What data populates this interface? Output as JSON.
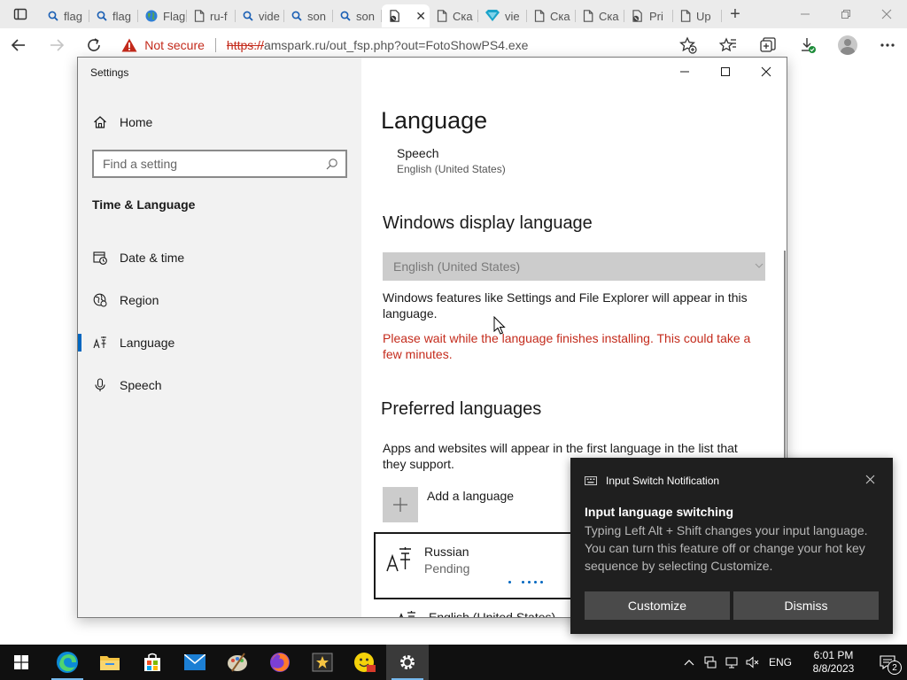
{
  "browser": {
    "tabs": [
      {
        "label": "flag",
        "icon": "search-icon"
      },
      {
        "label": "flag",
        "icon": "search-icon"
      },
      {
        "label": "Flag",
        "icon": "globe-icon"
      },
      {
        "label": "ru-f",
        "icon": "page-icon"
      },
      {
        "label": "vide",
        "icon": "search-icon"
      },
      {
        "label": "son",
        "icon": "search-icon"
      },
      {
        "label": "son",
        "icon": "search-icon"
      },
      {
        "label": "",
        "icon": "blocked-page-icon",
        "active": true
      },
      {
        "label": "Ска",
        "icon": "page-icon"
      },
      {
        "label": "vie",
        "icon": "diamond-icon"
      },
      {
        "label": "Ска",
        "icon": "page-icon"
      },
      {
        "label": "Ска",
        "icon": "page-icon"
      },
      {
        "label": "Pri",
        "icon": "blocked-page-icon"
      },
      {
        "label": "Up",
        "icon": "page-icon"
      }
    ],
    "security_label": "Not secure",
    "url_scheme": "https://",
    "url_rest": "amspark.ru/out_fsp.php?out=FotoShowPS4.exe"
  },
  "settings": {
    "window_title": "Settings",
    "home_label": "Home",
    "search_placeholder": "Find a setting",
    "section_heading": "Time & Language",
    "nav": {
      "date_time": "Date & time",
      "region": "Region",
      "language": "Language",
      "speech": "Speech"
    },
    "page_title": "Language",
    "speech_name": "Speech",
    "speech_value": "English (United States)",
    "display_heading": "Windows display language",
    "display_dropdown_value": "English (United States)",
    "display_desc": "Windows features like Settings and File Explorer will appear in this language.",
    "install_warning": "Please wait while the language finishes installing. This could take a few minutes.",
    "preferred_heading": "Preferred languages",
    "preferred_desc": "Apps and websites will appear in the first language in the list that they support.",
    "add_language_label": "Add a language",
    "languages": [
      {
        "name": "Russian",
        "status": "Pending"
      },
      {
        "name": "English (United States)"
      }
    ]
  },
  "toast": {
    "app_name": "Input Switch Notification",
    "title": "Input language switching",
    "body": "Typing Left Alt + Shift changes your input language. You can turn this feature off or change your hot key sequence by selecting Customize.",
    "customize_label": "Customize",
    "dismiss_label": "Dismiss"
  },
  "taskbar": {
    "input_language": "ENG",
    "time": "6:01 PM",
    "date": "8/8/2023",
    "notification_count": "2"
  },
  "colors": {
    "accent": "#0067c0",
    "warning_red": "#c42b1c",
    "toast_bg": "#1f1f1f",
    "taskbar_bg": "#101010"
  }
}
